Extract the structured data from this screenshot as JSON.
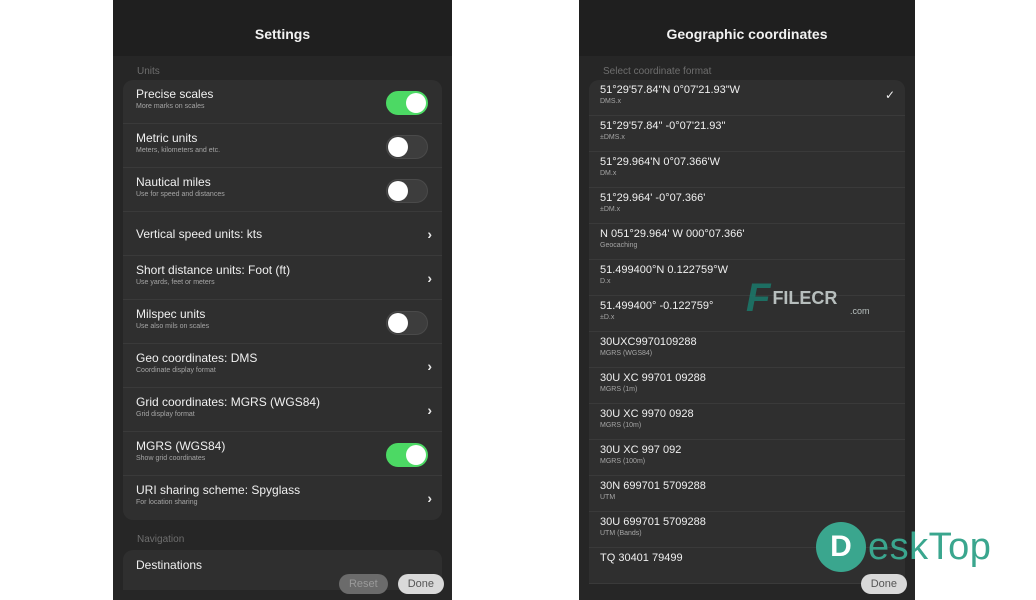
{
  "settings": {
    "title": "Settings",
    "section_units": "Units",
    "rows": [
      {
        "label": "Precise scales",
        "sub": "More marks on scales",
        "control": "toggle",
        "on": true
      },
      {
        "label": "Metric units",
        "sub": "Meters, kilometers and etc.",
        "control": "toggle",
        "on": false
      },
      {
        "label": "Nautical miles",
        "sub": "Use for speed and distances",
        "control": "toggle",
        "on": false
      },
      {
        "label": "Vertical speed units: kts",
        "sub": "",
        "control": "chevron"
      },
      {
        "label": "Short distance units: Foot (ft)",
        "sub": "Use yards, feet or meters",
        "control": "chevron"
      },
      {
        "label": "Milspec units",
        "sub": "Use also mils on scales",
        "control": "toggle",
        "on": false
      },
      {
        "label": "Geo coordinates: DMS",
        "sub": "Coordinate display format",
        "control": "chevron"
      },
      {
        "label": "Grid coordinates: MGRS (WGS84)",
        "sub": "Grid display format",
        "control": "chevron"
      },
      {
        "label": "MGRS (WGS84)",
        "sub": "Show grid coordinates",
        "control": "toggle",
        "on": true
      },
      {
        "label": "URI sharing scheme: Spyglass",
        "sub": "For location sharing",
        "control": "chevron"
      }
    ],
    "section_navigation": "Navigation",
    "partial_row": "Destinations",
    "reset_label": "Reset",
    "done_label": "Done"
  },
  "geo": {
    "title": "Geographic coordinates",
    "section_label": "Select coordinate format",
    "rows": [
      {
        "label": "51°29'57.84\"N 0°07'21.93\"W",
        "sub": "DMS.x",
        "selected": true
      },
      {
        "label": "51°29'57.84\" -0°07'21.93\"",
        "sub": "±DMS.x",
        "selected": false
      },
      {
        "label": "51°29.964'N 0°07.366'W",
        "sub": "DM.x",
        "selected": false
      },
      {
        "label": "51°29.964' -0°07.366'",
        "sub": "±DM.x",
        "selected": false
      },
      {
        "label": "N 051°29.964' W 000°07.366'",
        "sub": "Geocaching",
        "selected": false
      },
      {
        "label": "51.499400°N 0.122759°W",
        "sub": "D.x",
        "selected": false
      },
      {
        "label": "51.499400° -0.122759°",
        "sub": "±D.x",
        "selected": false
      },
      {
        "label": "30UXC9970109288",
        "sub": "MGRS (WGS84)",
        "selected": false
      },
      {
        "label": "30U XC 99701 09288",
        "sub": "MGRS (1m)",
        "selected": false
      },
      {
        "label": "30U XC 9970 0928",
        "sub": "MGRS (10m)",
        "selected": false
      },
      {
        "label": "30U XC 997 092",
        "sub": "MGRS (100m)",
        "selected": false
      },
      {
        "label": "30N 699701 5709288",
        "sub": "UTM",
        "selected": false
      },
      {
        "label": "30U 699701 5709288",
        "sub": "UTM (Bands)",
        "selected": false
      },
      {
        "label": "TQ 30401 79499",
        "sub": "",
        "selected": false
      }
    ],
    "done_label": "Done"
  },
  "watermarks": {
    "filecr_letter": "F",
    "filecr_text": "FILECR",
    "filecr_sub": ".com",
    "desktop_letter": "D",
    "desktop_text": "eskTop"
  }
}
